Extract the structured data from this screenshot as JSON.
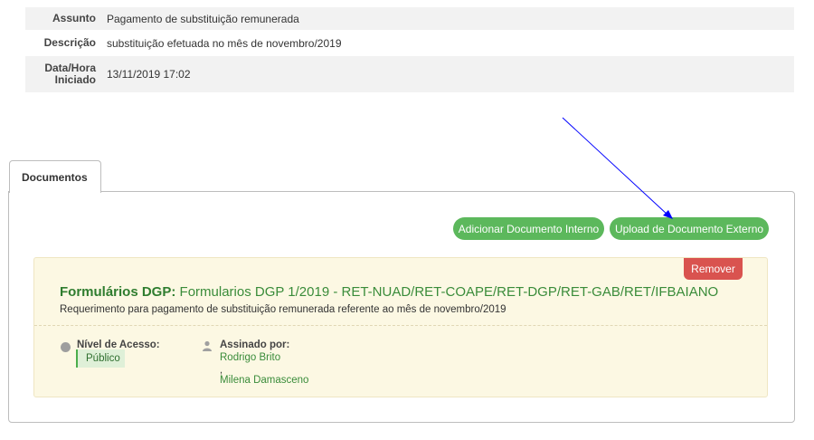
{
  "info": {
    "subject_label": "Assunto",
    "subject_value": "Pagamento de substituição remunerada",
    "description_label": "Descrição",
    "description_value": "substituição efetuada no mês de novembro/2019",
    "datetime_label_line1": "Data/Hora",
    "datetime_label_line2": "Iniciado",
    "datetime_value": "13/11/2019 17:02"
  },
  "tabs": {
    "documents_label": "Documentos"
  },
  "actions": {
    "add_internal_label": "Adicionar Documento Interno",
    "upload_external_label": "Upload de Documento Externo"
  },
  "document": {
    "remove_label": "Remover",
    "type": "Formulários DGP:",
    "title": "Formularios DGP 1/2019 - RET-NUAD/RET-COAPE/RET-DGP/RET-GAB/RET/IFBAIANO",
    "description": "Requerimento para pagamento de substituição remunerada referente ao mês de novembro/2019",
    "access_label": "Nível de Acesso:",
    "access_value": "Público",
    "signed_label": "Assinado por:",
    "signers": [
      "Rodrigo Brito",
      "Milena Damasceno"
    ],
    "signer_separator": ","
  },
  "colors": {
    "button_green": "#5cb85c",
    "remove_red": "#d9534f",
    "card_bg": "#fcf8e3",
    "arrow_blue": "#0000ff"
  },
  "icons": [
    "circle-icon",
    "user-icon",
    "arrow-annotation"
  ]
}
